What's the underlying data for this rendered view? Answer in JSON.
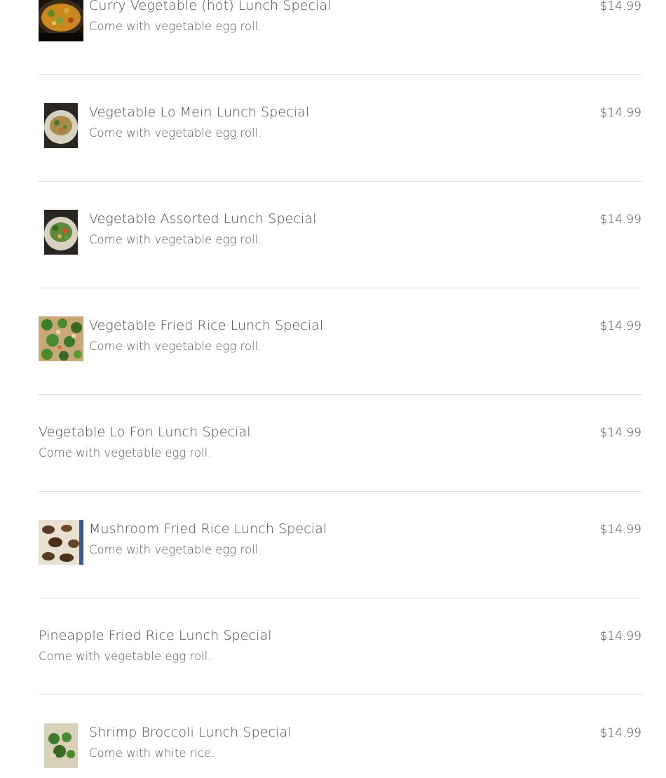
{
  "items": [
    {
      "title": "Curry Vegetable (hot) Lunch Special",
      "description": "Come with vegetable egg roll.",
      "price": "$14.99",
      "photo": "curry-vegetable-photo"
    },
    {
      "title": "Vegetable Lo Mein Lunch Special",
      "description": "Come with vegetable egg roll.",
      "price": "$14.99",
      "photo": "lo-mein-photo"
    },
    {
      "title": "Vegetable Assorted Lunch Special",
      "description": "Come with vegetable egg roll.",
      "price": "$14.99",
      "photo": "assorted-vegetable-photo"
    },
    {
      "title": "Vegetable Fried Rice Lunch Special",
      "description": "Come with vegetable egg roll.",
      "price": "$14.99",
      "photo": "fried-rice-photo"
    },
    {
      "title": "Vegetable Lo Fon Lunch Special",
      "description": "Come with vegetable egg roll.",
      "price": "$14.99"
    },
    {
      "title": "Mushroom Fried Rice Lunch Special",
      "description": "Come with vegetable egg roll.",
      "price": "$14.99",
      "photo": "mushroom-fried-rice-photo"
    },
    {
      "title": "Pineapple Fried Rice Lunch Special",
      "description": "Come with vegetable egg roll.",
      "price": "$14.99"
    },
    {
      "title": "Shrimp Broccoli Lunch Special",
      "description": "Come with white rice.",
      "price": "$14.99",
      "photo": "shrimp-broccoli-photo"
    }
  ],
  "colors": {
    "text": "#4b4b4b",
    "divider": "#dcdcdc",
    "background": "#ffffff"
  }
}
